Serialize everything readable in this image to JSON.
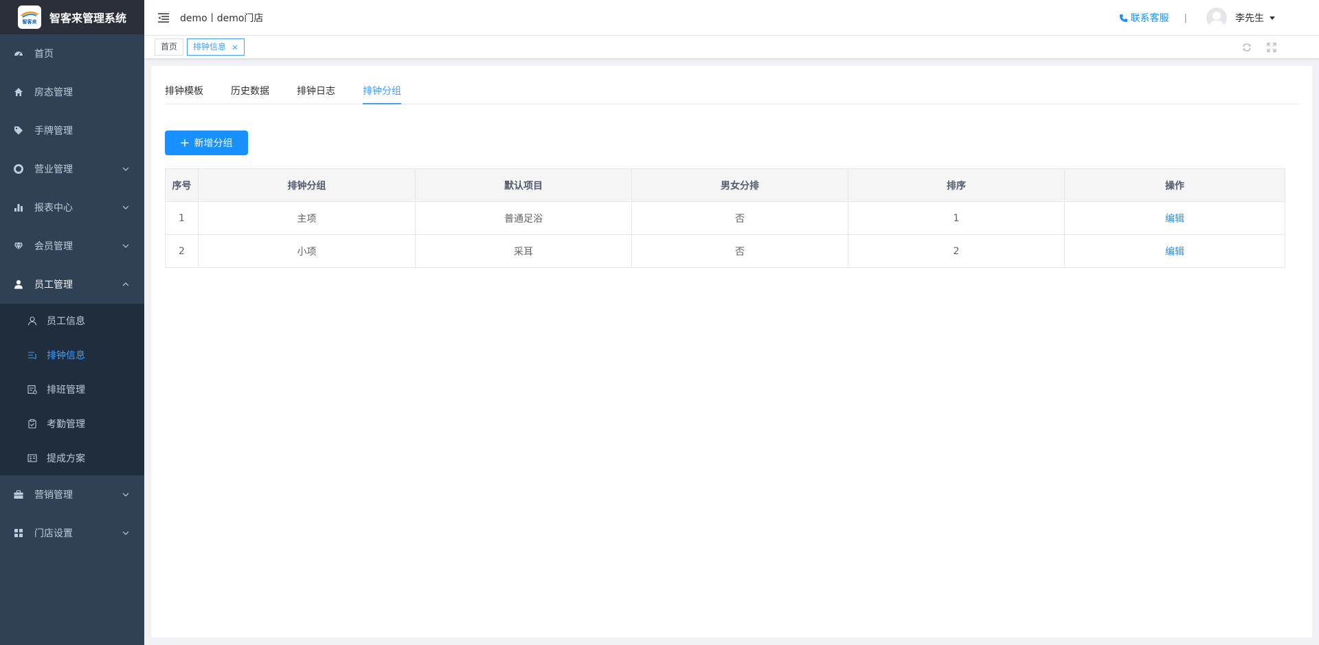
{
  "app": {
    "title": "智客来管理系统",
    "logo_text": "智客来"
  },
  "sidebar": {
    "items": [
      {
        "label": "首页",
        "icon": "dashboard-icon"
      },
      {
        "label": "房态管理",
        "icon": "home-icon"
      },
      {
        "label": "手牌管理",
        "icon": "tag-icon"
      },
      {
        "label": "营业管理",
        "icon": "lifebuoy-icon"
      },
      {
        "label": "报表中心",
        "icon": "bar-chart-icon"
      },
      {
        "label": "会员管理",
        "icon": "diamond-icon"
      },
      {
        "label": "员工管理",
        "icon": "user-icon"
      },
      {
        "label": "营销管理",
        "icon": "briefcase-icon"
      },
      {
        "label": "门店设置",
        "icon": "grid-icon"
      }
    ],
    "sub_items": [
      {
        "label": "员工信息",
        "icon": "person-outline-icon"
      },
      {
        "label": "排钟信息",
        "icon": "list-icon"
      },
      {
        "label": "排班管理",
        "icon": "schedule-icon"
      },
      {
        "label": "考勤管理",
        "icon": "clipboard-check-icon"
      },
      {
        "label": "提成方案",
        "icon": "document-icon"
      }
    ]
  },
  "navbar": {
    "store": "demo丨demo门店",
    "contact": "联系客服",
    "separator": "|",
    "user": "李先生"
  },
  "tags": [
    {
      "label": "首页"
    },
    {
      "label": "排钟信息"
    }
  ],
  "tabs": [
    {
      "label": "排钟模板"
    },
    {
      "label": "历史数据"
    },
    {
      "label": "排钟日志"
    },
    {
      "label": "排钟分组"
    }
  ],
  "add_button": "新增分组",
  "table": {
    "headers": [
      "序号",
      "排钟分组",
      "默认项目",
      "男女分排",
      "排序",
      "操作"
    ],
    "rows": [
      {
        "no": "1",
        "group": "主项",
        "item": "普通足浴",
        "gender": "否",
        "order": "1",
        "action": "编辑"
      },
      {
        "no": "2",
        "group": "小项",
        "item": "采耳",
        "gender": "否",
        "order": "2",
        "action": "编辑"
      }
    ]
  },
  "colors": {
    "sidebar_bg": "#304156",
    "submenu_bg": "#1f2d3d",
    "accent": "#409eff",
    "primary_button": "#1890ff"
  }
}
